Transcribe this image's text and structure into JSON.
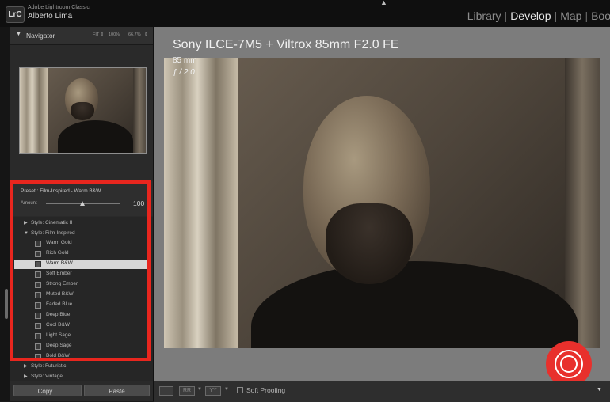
{
  "window": {
    "app_name": "Adobe Lightroom Classic",
    "user_name": "Alberto Lima",
    "logo_text": "LrC"
  },
  "modules": {
    "items": [
      "Library",
      "Develop",
      "Map",
      "Boo"
    ],
    "active": "Develop",
    "separator": "|"
  },
  "navigator": {
    "title": "Navigator",
    "zoom_options": [
      "FIT ⇕",
      "100%",
      "66.7%",
      "⇕"
    ]
  },
  "preset": {
    "label": "Preset : Film-Inspired - Warm B&W",
    "amount_label": "Amount",
    "amount_value": "100",
    "amount_fraction": 1.0
  },
  "preset_list": {
    "groups": [
      {
        "label": "Style: Cinematic II",
        "expanded": false
      },
      {
        "label": "Style: Film-Inspired",
        "expanded": true
      },
      {
        "label": "Style: Futuristic",
        "expanded": false
      },
      {
        "label": "Style: Vintage",
        "expanded": false
      }
    ],
    "items": [
      "Warm Gold",
      "Rich Gold",
      "Warm B&W",
      "Soft Ember",
      "Strong Ember",
      "Muted B&W",
      "Faded Blue",
      "Deep Blue",
      "Cool B&W",
      "Light Sage",
      "Deep Sage",
      "Bold B&W"
    ],
    "selected": "Warm B&W"
  },
  "buttons": {
    "copy": "Copy...",
    "paste": "Paste"
  },
  "photo": {
    "camera_lens": "Sony ILCE-7M5 + Viltrox 85mm F2.0 FE",
    "focal_length": "85 mm",
    "aperture": "ƒ / 2.0"
  },
  "toolbar": {
    "view_buttons": [
      "RR",
      "YY"
    ],
    "soft_proofing_label": "Soft Proofing",
    "soft_proofing_checked": false
  },
  "colors": {
    "highlight_box": "#e8261e",
    "badge": "#e8302c"
  }
}
